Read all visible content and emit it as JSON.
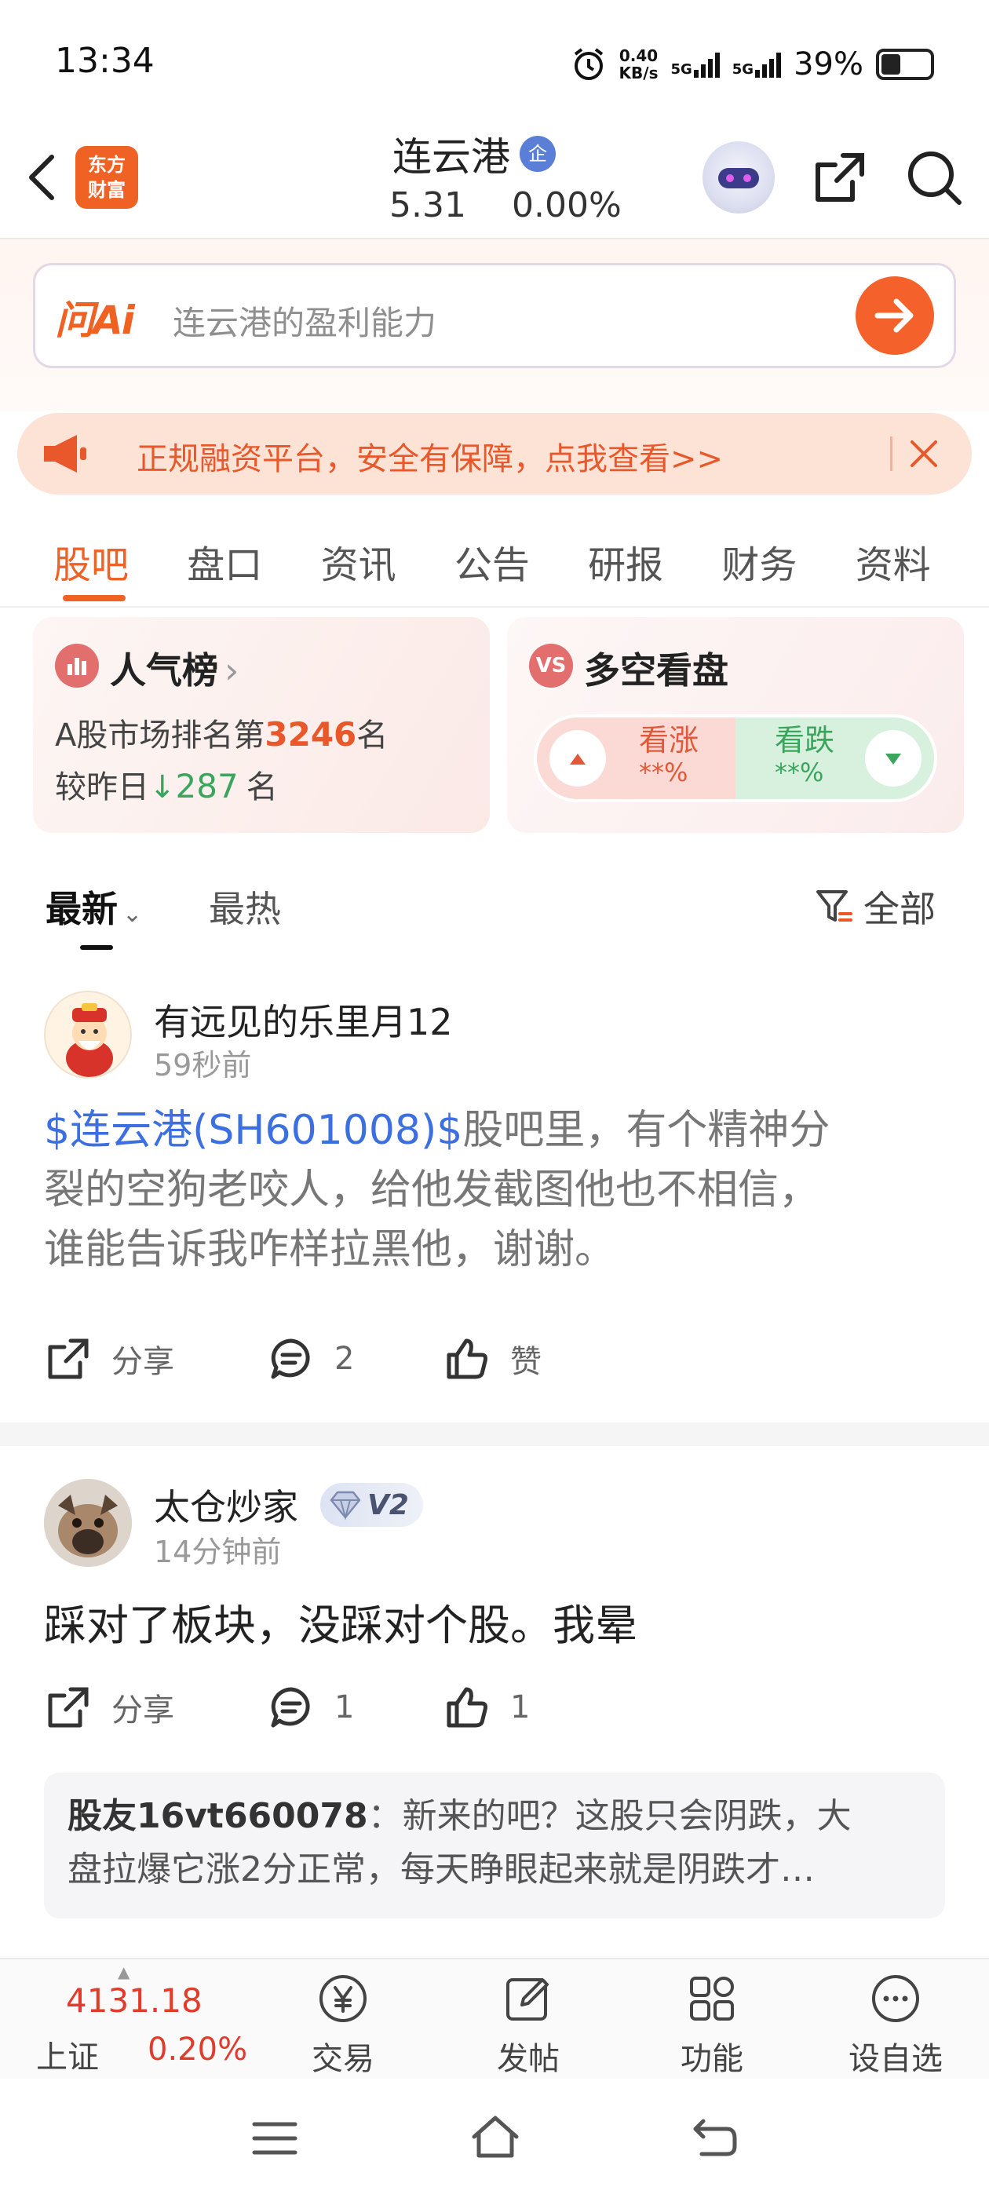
{
  "status_bar": {
    "time": "13:34",
    "net_speed_value": "0.40",
    "net_speed_unit": "KB/s",
    "signal1_label": "5G",
    "signal2_label": "5G",
    "battery": "39%"
  },
  "header": {
    "logo_line1": "东方",
    "logo_line2": "财富",
    "stock_name": "连云港",
    "stock_badge": "企",
    "price": "5.31",
    "change_pct": "0.00%"
  },
  "ai_search": {
    "logo": "问Ai",
    "placeholder": "连云港的盈利能力"
  },
  "promo": {
    "text": "正规融资平台，安全有保障，点我查看>>"
  },
  "tabs": [
    "股吧",
    "盘口",
    "资讯",
    "公告",
    "研报",
    "财务",
    "资料"
  ],
  "popularity": {
    "title": "人气榜",
    "rank_prefix": "A股市场排名第",
    "rank": "3246",
    "rank_suffix": "名",
    "change_prefix": "较昨日",
    "change_value": "287",
    "change_suffix": "名"
  },
  "long_short": {
    "title": "多空看盘",
    "icon_text": "VS",
    "up_label": "看涨",
    "up_pct": "**%",
    "down_label": "看跌",
    "down_pct": "**%"
  },
  "sort": {
    "latest": "最新",
    "hot": "最热",
    "filter": "全部"
  },
  "posts": [
    {
      "user": "有远见的乐里月12",
      "time": "59秒前",
      "cashtag": "$连云港(SH601008)$",
      "body_line1_rest": "股吧里，有个精神分",
      "body_line2": "裂的空狗老咬人，给他发截图他也不相信，",
      "body_line3": "谁能告诉我咋样拉黑他，谢谢。",
      "share": "分享",
      "comments": "2",
      "likes": "赞"
    },
    {
      "user": "太仓炒家",
      "level": "V2",
      "time": "14分钟前",
      "body": "踩对了板块，没踩对个股。我晕",
      "share": "分享",
      "comments": "1",
      "likes": "1",
      "reply_user": "股友16vt660078",
      "reply_line1": "：新来的吧？这股只会阴跌，大",
      "reply_line2": "盘拉爆它涨2分正常，每天睁眼起来就是阴跌才…"
    }
  ],
  "bottom_nav": {
    "index_value": "4131.18",
    "index_name": "上证",
    "index_pct": "0.20%",
    "trade": "交易",
    "post": "发帖",
    "functions": "功能",
    "watchlist": "设自选"
  },
  "colors": {
    "brand": "#f06124",
    "up": "#e03b2b",
    "down": "#3aa55c",
    "link": "#3c6fe0"
  }
}
